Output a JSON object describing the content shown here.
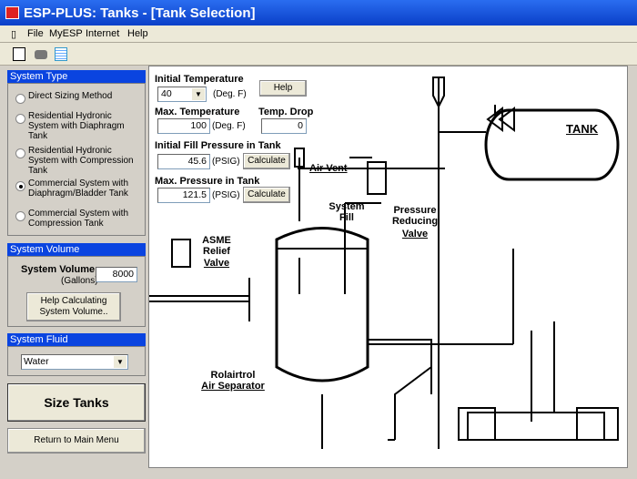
{
  "window": {
    "title": "ESP-PLUS: Tanks - [Tank Selection]"
  },
  "menu": [
    {
      "label": "File"
    },
    {
      "label": "MyESP"
    },
    {
      "label": "Internet"
    },
    {
      "label": "Help"
    }
  ],
  "toolbar": {
    "icons": [
      "new-document-icon",
      "print-icon",
      "notes-icon"
    ]
  },
  "system_type": {
    "header": "System Type",
    "options": [
      {
        "label": "Direct Sizing Method",
        "selected": false
      },
      {
        "label": "Residential Hydronic System with Diaphragm Tank",
        "selected": false
      },
      {
        "label": "Residential Hydronic System with Compression Tank",
        "selected": false
      },
      {
        "label": "Commercial System with Diaphragm/Bladder Tank",
        "selected": true
      },
      {
        "label": "Commercial System with Compression Tank",
        "selected": false
      }
    ]
  },
  "system_volume": {
    "header": "System Volume",
    "label": "System Volume",
    "unit": "(Gallons)",
    "value": "8000",
    "help_button": "Help Calculating System Volume.."
  },
  "system_fluid": {
    "header": "System Fluid",
    "value": "Water"
  },
  "size_tanks": "Size Tanks",
  "return_button": "Return to Main Menu",
  "form": {
    "initial_temp_label": "Initial Temperature",
    "initial_temp_value": "40",
    "deg_f": "(Deg. F)",
    "help_button": "Help",
    "max_temp_label": "Max. Temperature",
    "max_temp_value": "100",
    "temp_drop_label": "Temp. Drop",
    "temp_drop_value": "0",
    "fill_pressure_label": "Initial Fill Pressure in Tank",
    "fill_pressure_value": "45.6",
    "psig": "(PSIG)",
    "calculate": "Calculate",
    "max_pressure_label": "Max. Pressure in Tank",
    "max_pressure_value": "121.5"
  },
  "diagram": {
    "tank": "TANK",
    "air_vent": "Air Vent",
    "system_fill": "System Fill",
    "prv": "Pressure Reducing",
    "prv2": "Valve",
    "asme": "ASME Relief",
    "asme2": "Valve",
    "sep1": "Rolairtrol",
    "sep2": "Air Separator"
  }
}
